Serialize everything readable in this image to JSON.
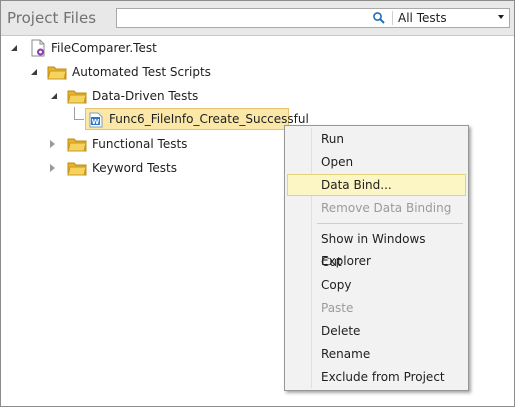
{
  "panel": {
    "title": "Project Files"
  },
  "search": {
    "value": "",
    "placeholder": "",
    "filter_value": "All Tests"
  },
  "tree": {
    "root": "FileComparer.Test",
    "automated": "Automated Test Scripts",
    "data_driven": "Data-Driven Tests",
    "selected_file": "Func6_FileInfo_Create_Successful",
    "functional": "Functional Tests",
    "keyword": "Keyword Tests"
  },
  "context_menu": {
    "run": "Run",
    "open": "Open",
    "data_bind": "Data Bind...",
    "remove_data_binding": "Remove Data Binding",
    "show_in_explorer": "Show in Windows Explorer",
    "cut": "Cut",
    "copy": "Copy",
    "paste": "Paste",
    "delete": "Delete",
    "rename": "Rename",
    "exclude": "Exclude from Project"
  },
  "colors": {
    "selection": "#fbe8a8",
    "menu_hover": "#fcf6c4",
    "folder": "#f2c343",
    "file_badge": "#2b78c5"
  }
}
